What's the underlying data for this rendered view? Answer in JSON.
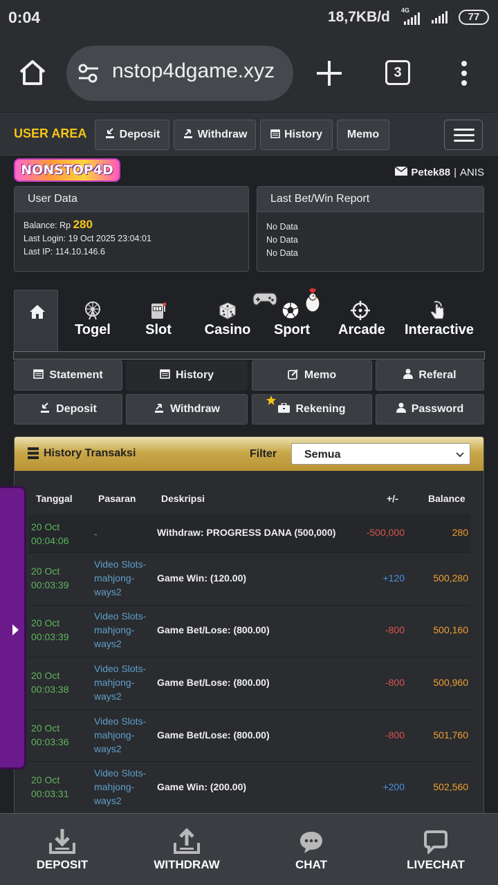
{
  "statusbar": {
    "time": "0:04",
    "speed": "18,7KB/d",
    "network": "4G",
    "battery": "77"
  },
  "browser": {
    "url": "nstop4dgame.xyz",
    "tabs_count": "3"
  },
  "userarea": {
    "title": "USER AREA",
    "buttons": [
      {
        "label": "Deposit",
        "icon": "deposit-icon"
      },
      {
        "label": "Withdraw",
        "icon": "withdraw-icon"
      },
      {
        "label": "History",
        "icon": "calendar-icon"
      },
      {
        "label": "Memo"
      }
    ]
  },
  "brand": {
    "logo_text": "NONSTOP4D"
  },
  "user": {
    "username": "Petek88",
    "separator": "|",
    "name": "ANIS"
  },
  "user_data": {
    "title": "User Data",
    "balance_label": "Balance: Rp",
    "balance_value": "280",
    "last_login": "Last Login: 19 Oct 2025 23:04:01",
    "last_ip": "Last IP: 114.10.146.6"
  },
  "report": {
    "title": "Last Bet/Win Report",
    "lines": [
      "No Data",
      "No Data",
      "No Data"
    ]
  },
  "categories": [
    {
      "label": "Togel",
      "icon": "ferris-wheel-icon"
    },
    {
      "label": "Slot",
      "icon": "slot-machine-icon"
    },
    {
      "label": "Casino",
      "icon": "dice-icon"
    },
    {
      "label": "Sport",
      "icon": "soccer-ball-icon"
    },
    {
      "label": "Arcade",
      "icon": "crosshair-icon"
    },
    {
      "label": "Interactive",
      "icon": "touch-icon"
    }
  ],
  "menu": [
    {
      "label": "Statement",
      "icon": "calendar-icon"
    },
    {
      "label": "History",
      "icon": "calendar-icon"
    },
    {
      "label": "Memo",
      "icon": "edit-icon"
    },
    {
      "label": "Referal",
      "icon": "user-icon"
    },
    {
      "label": "Deposit",
      "icon": "deposit-icon"
    },
    {
      "label": "Withdraw",
      "icon": "withdraw-icon"
    },
    {
      "label": "Rekening",
      "icon": "briefcase-icon"
    },
    {
      "label": "Password",
      "icon": "user-icon"
    }
  ],
  "history": {
    "title": "History Transaksi",
    "filter_label": "Filter",
    "filter_value": "Semua",
    "columns": [
      "Tanggal",
      "Pasaran",
      "Deskripsi",
      "+/-",
      "Balance"
    ],
    "rows": [
      {
        "date": "20 Oct",
        "time": "00:04:06",
        "pasaran": "-",
        "desc": "Withdraw: PROGRESS DANA (500,000)",
        "amount": "-500,000",
        "sign": "neg",
        "balance": "280"
      },
      {
        "date": "20 Oct",
        "time": "00:03:39",
        "pasaran": "Video Slots-mahjong-ways2",
        "desc": "Game Win: (120.00)",
        "amount": "+120",
        "sign": "pos",
        "balance": "500,280"
      },
      {
        "date": "20 Oct",
        "time": "00:03:39",
        "pasaran": "Video Slots-mahjong-ways2",
        "desc": "Game Bet/Lose: (800.00)",
        "amount": "-800",
        "sign": "neg",
        "balance": "500,160"
      },
      {
        "date": "20 Oct",
        "time": "00:03:38",
        "pasaran": "Video Slots-mahjong-ways2",
        "desc": "Game Bet/Lose: (800.00)",
        "amount": "-800",
        "sign": "neg",
        "balance": "500,960"
      },
      {
        "date": "20 Oct",
        "time": "00:03:36",
        "pasaran": "Video Slots-mahjong-ways2",
        "desc": "Game Bet/Lose: (800.00)",
        "amount": "-800",
        "sign": "neg",
        "balance": "501,760"
      },
      {
        "date": "20 Oct",
        "time": "00:03:31",
        "pasaran": "Video Slots-mahjong-ways2",
        "desc": "Game Win: (200.00)",
        "amount": "+200",
        "sign": "pos",
        "balance": "502,560"
      }
    ]
  },
  "bottomnav": [
    {
      "label": "DEPOSIT",
      "icon": "download-tray-icon"
    },
    {
      "label": "WITHDRAW",
      "icon": "upload-tray-icon"
    },
    {
      "label": "CHAT",
      "icon": "chat-bubble-icon"
    },
    {
      "label": "LIVECHAT",
      "icon": "livechat-icon"
    }
  ],
  "colors": {
    "accent_yellow": "#f5c518",
    "positive": "#4a90e2",
    "negative": "#d9534f",
    "balance": "#f0a030",
    "date_green": "#5fb55f",
    "pasaran_blue": "#5ea0c8"
  }
}
